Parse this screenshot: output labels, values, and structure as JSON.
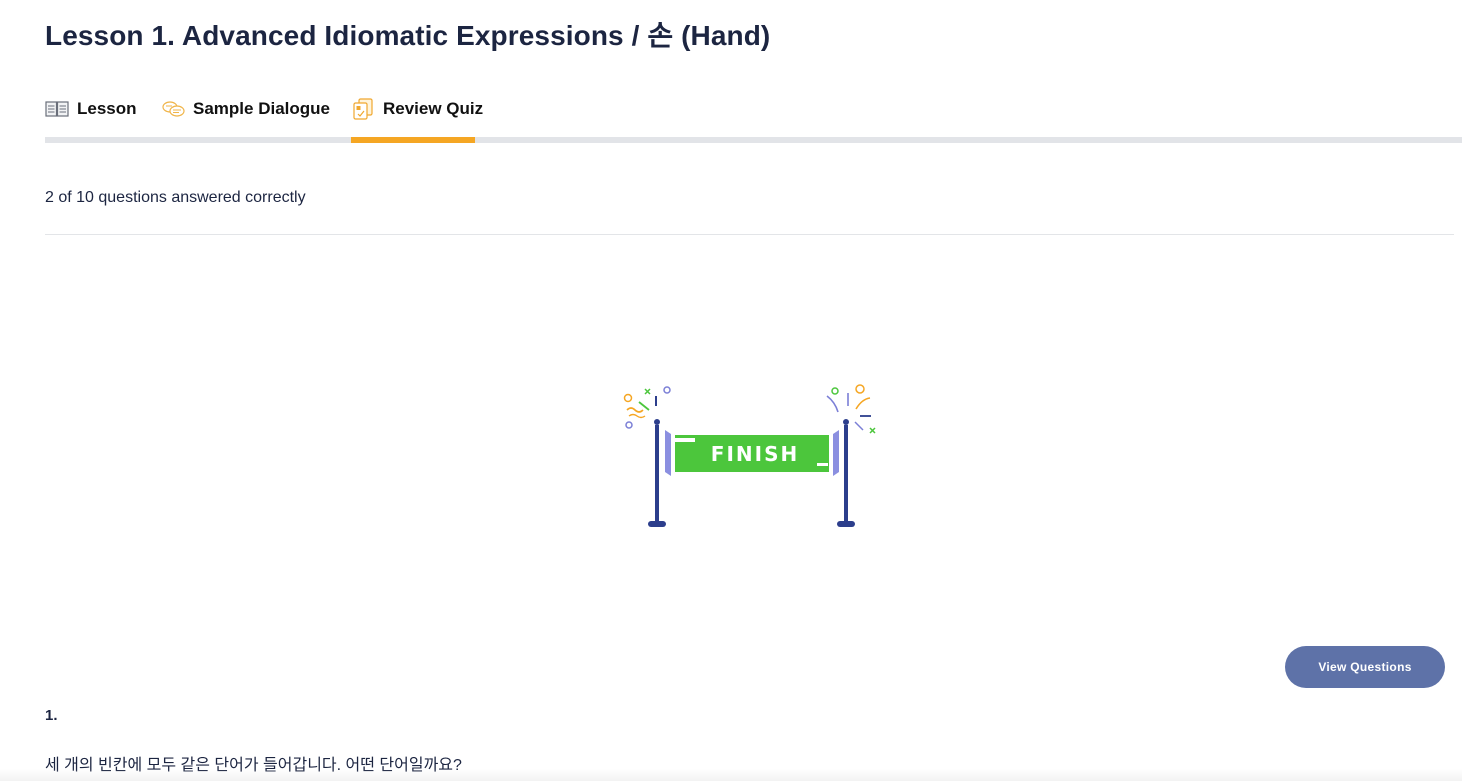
{
  "page": {
    "title": "Lesson 1. Advanced Idiomatic Expressions / 손 (Hand)"
  },
  "tabs": [
    {
      "label": "Lesson",
      "icon": "book-icon",
      "active": false
    },
    {
      "label": "Sample Dialogue",
      "icon": "dialogue-bubbles-icon",
      "active": false
    },
    {
      "label": "Review Quiz",
      "icon": "quiz-cards-icon",
      "active": true
    }
  ],
  "quiz": {
    "score_text": "2 of 10 questions answered correctly",
    "finish_banner_text": "FINISH",
    "view_questions_label": "View Questions",
    "question_number": "1.",
    "question_text": "세 개의 빈칸에 모두 같은 단어가 들어갑니다. 어떤 단어일까요?"
  },
  "colors": {
    "title": "#1c2541",
    "active_tab_underline": "#f5a623",
    "tab_track": "#e2e4e8",
    "button": "#5e72a8",
    "finish_banner": "#4cc63c",
    "finish_posts": "#2c3e8c"
  }
}
